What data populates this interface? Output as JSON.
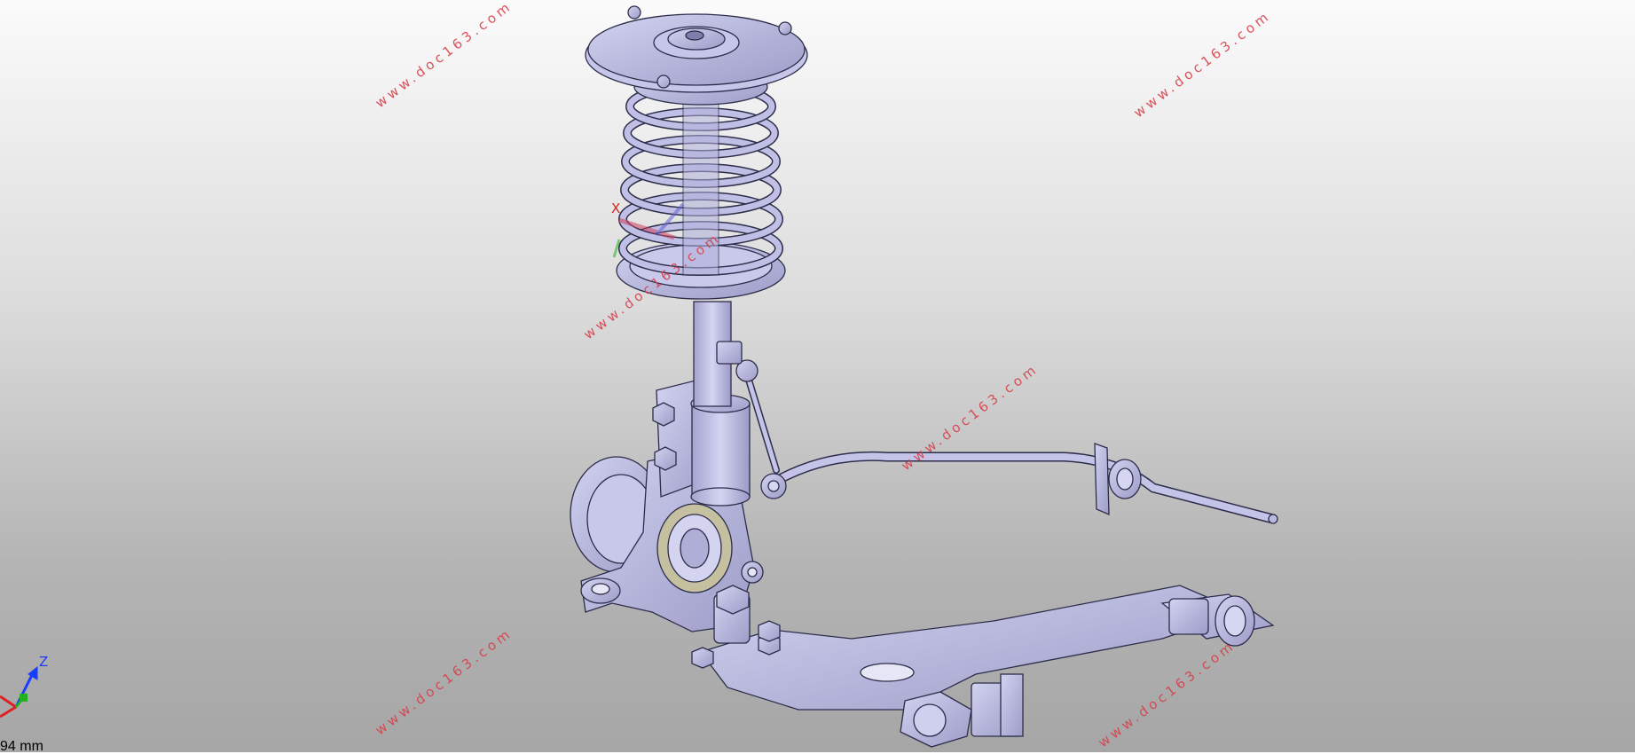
{
  "viewer": {
    "watermark": "www.doc163.com",
    "compass_axis_label": "X",
    "triad_axis_label": "Z",
    "scale_label": "94 mm"
  },
  "colors": {
    "part_fill": "#b9b9e2",
    "part_stroke": "#2d2d4a",
    "watermark": "#d6404a",
    "axis_x": "#e02020",
    "axis_y": "#20b020",
    "axis_z": "#1a3cff"
  }
}
